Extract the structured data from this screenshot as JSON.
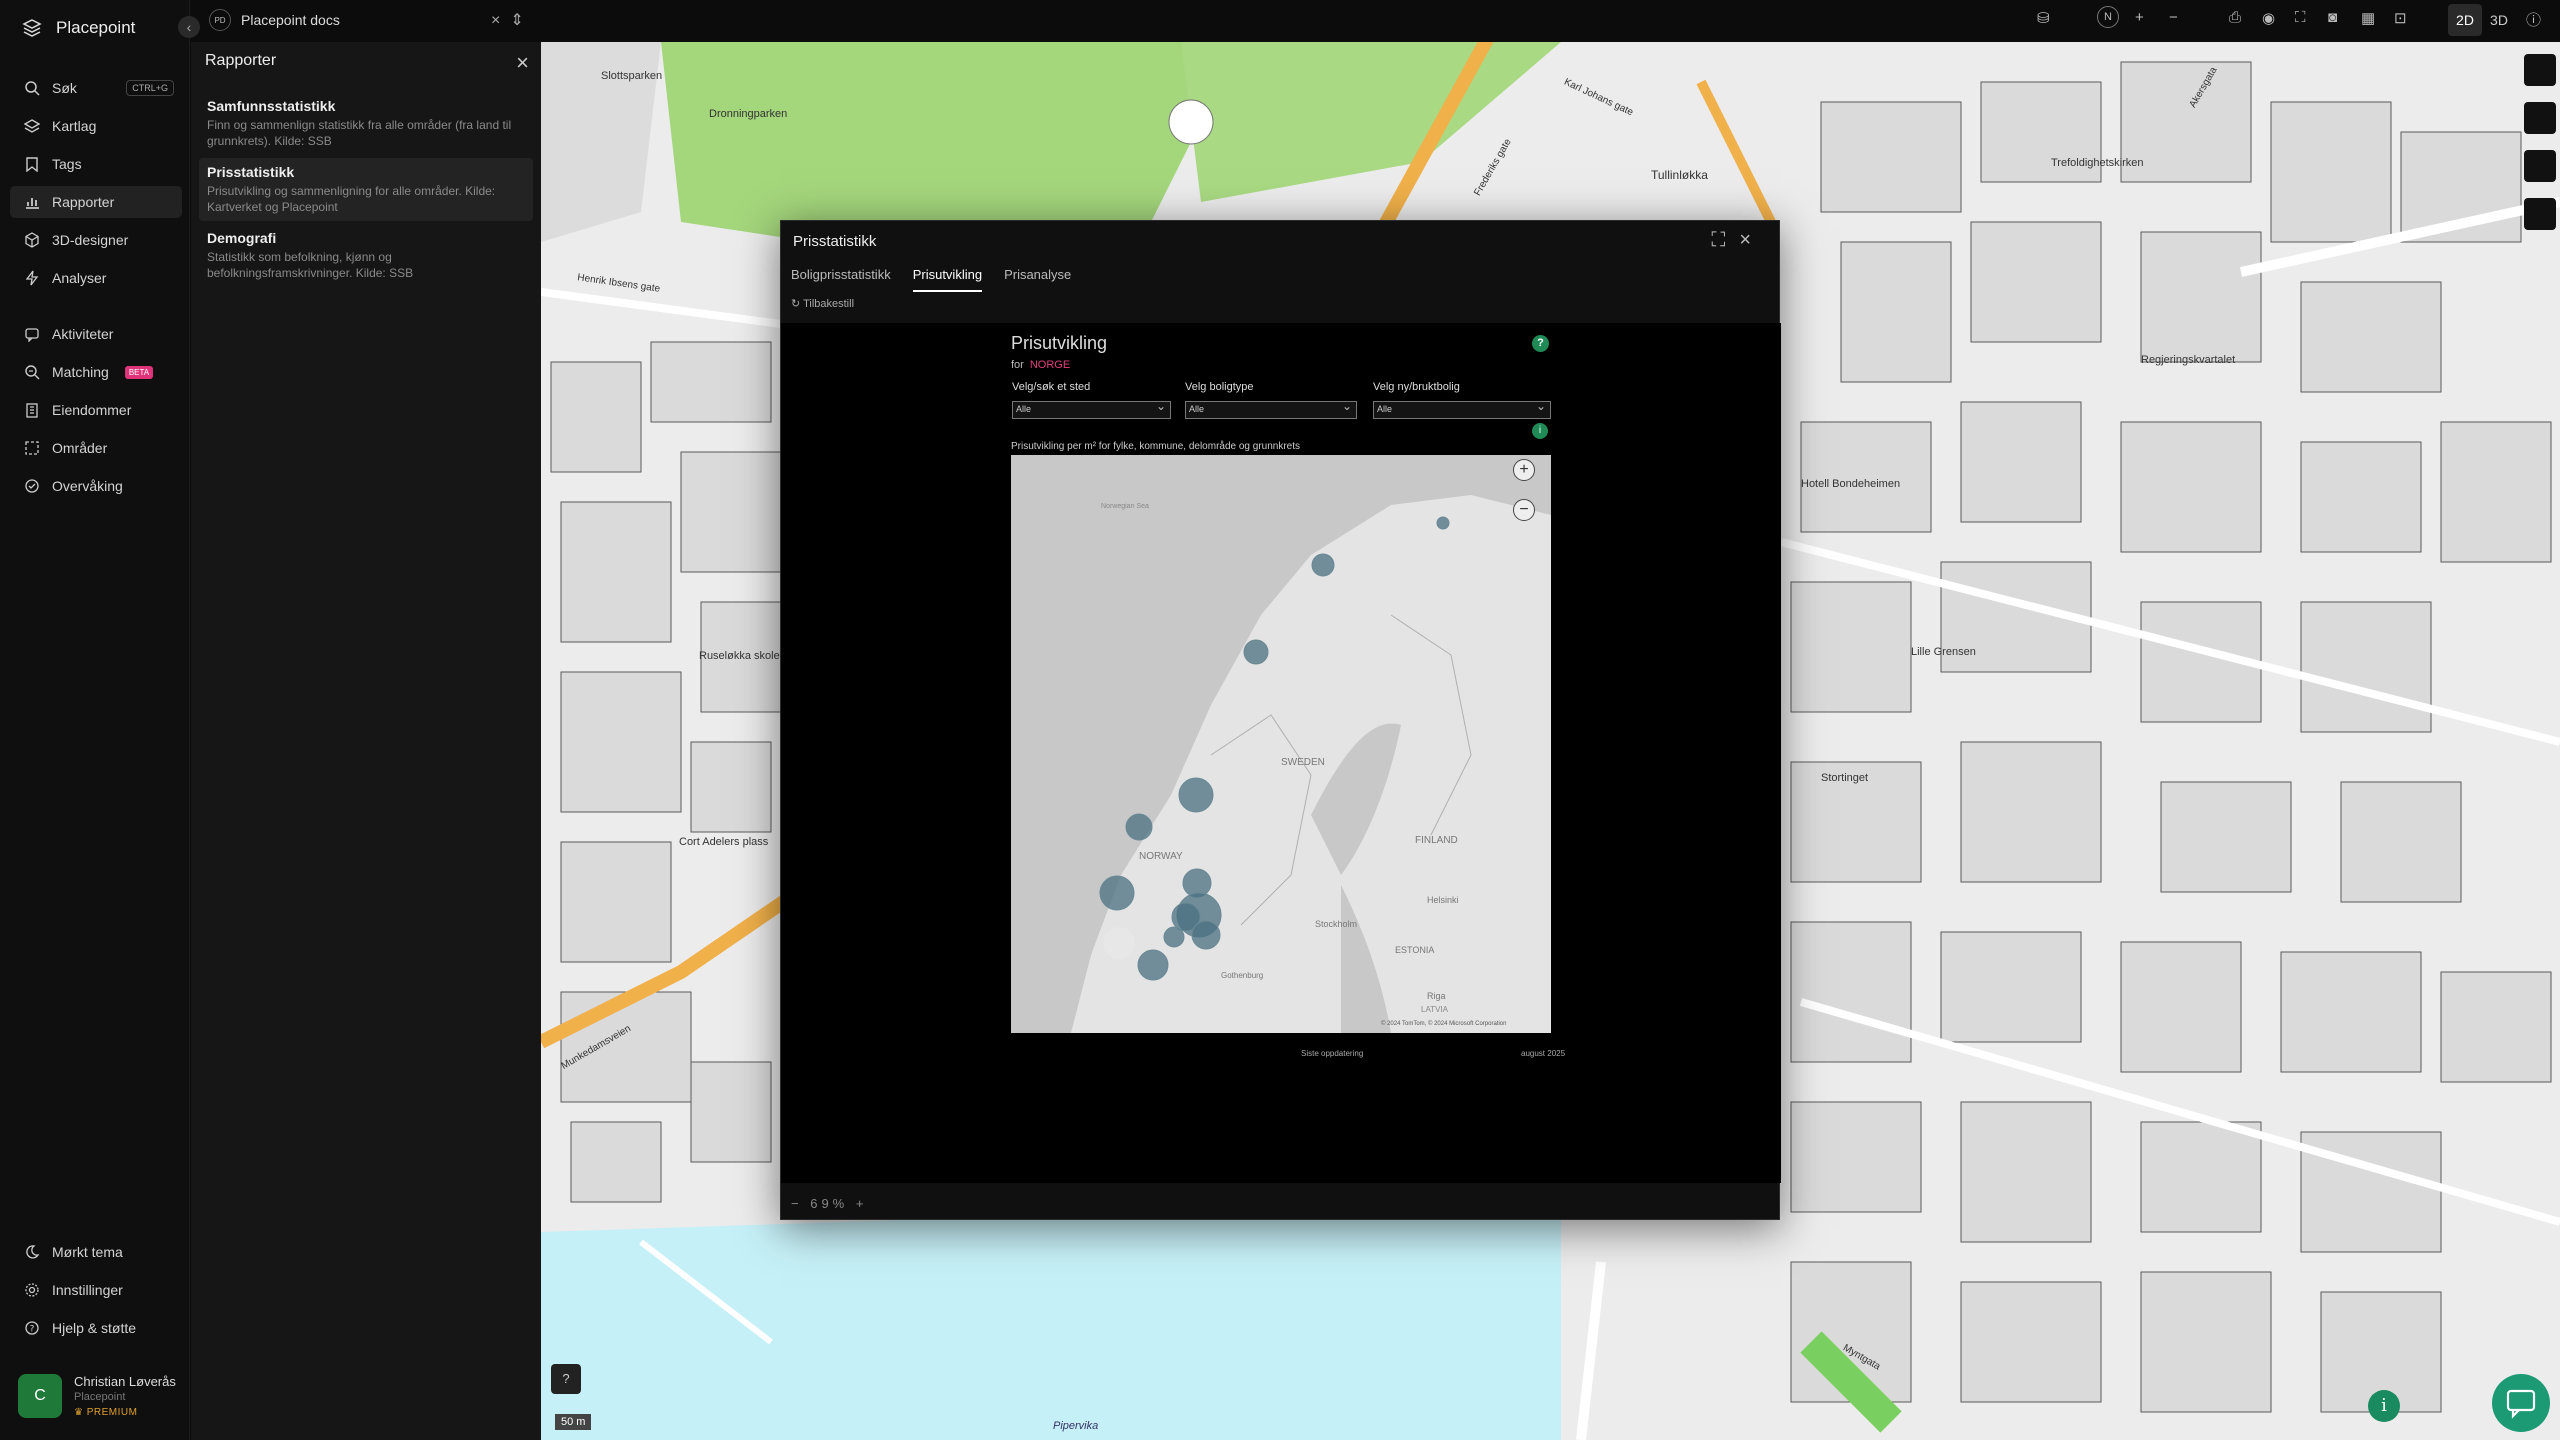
{
  "app": {
    "name": "Placepoint"
  },
  "nav": {
    "search": "Søk",
    "search_shortcut": "CTRL+G",
    "maplayers": "Kartlag",
    "tags": "Tags",
    "reports": "Rapporter",
    "designer3d": "3D-designer",
    "analyses": "Analyser",
    "activities": "Aktiviteter",
    "matching": "Matching",
    "matching_badge": "BETA",
    "properties": "Eiendommer",
    "areas": "Områder",
    "monitoring": "Overvåking",
    "dark_theme": "Mørkt tema",
    "settings": "Innstillinger",
    "help": "Hjelp & støtte"
  },
  "user": {
    "name": "Christian Løverås",
    "org": "Placepoint",
    "plan": "PREMIUM",
    "initial": "C"
  },
  "topbar": {
    "doc_badge": "PD",
    "doc_name": "Placepoint docs",
    "mode_2d": "2D",
    "mode_3d": "3D",
    "north": "N"
  },
  "panel": {
    "title": "Rapporter",
    "items": [
      {
        "title": "Samfunnsstatistikk",
        "desc": "Finn og sammenlign statistikk fra alle områder (fra land til grunnkrets). Kilde: SSB"
      },
      {
        "title": "Prisstatistikk",
        "desc": "Prisutvikling og sammenligning for alle områder. Kilde: Kartverket og Placepoint"
      },
      {
        "title": "Demografi",
        "desc": "Statistikk som befolkning, kjønn og befolkningsframskrivninger. Kilde: SSB"
      }
    ]
  },
  "modal": {
    "title": "Prisstatistikk",
    "tabs": [
      "Boligprisstatistikk",
      "Prisutvikling",
      "Prisanalyse"
    ],
    "reset": "Tilbakestill",
    "zoom": "69%"
  },
  "report": {
    "title": "Prisutvikling",
    "for_label": "for",
    "for_value": "NORGE",
    "filter1_label": "Velg/søk et sted",
    "filter1_value": "Alle",
    "filter2_label": "Velg boligtype",
    "filter2_value": "Alle",
    "filter3_label": "Velg ny/bruktbolig",
    "filter3_value": "Alle",
    "subtitle": "Prisutvikling per m² for fylke, kommune, delområde og grunnkrets",
    "map_labels": {
      "sweden": "SWEDEN",
      "norway": "NORWAY",
      "finland": "FINLAND",
      "stockholm": "Stockholm",
      "helsinki": "Helsinki",
      "estonia": "ESTONIA",
      "latvia": "LATVIA",
      "riga": "Riga",
      "gothenburg": "Gothenburg",
      "sea": "Norwegian Sea",
      "copyright": "© 2024 TomTom, © 2024 Microsoft Corporation"
    },
    "updated_label": "Siste oppdatering",
    "updated_value": "august 2025"
  },
  "map": {
    "scale": "50 m",
    "labels": {
      "slottsparken": "Slottsparken",
      "dronningparken": "Dronningparken",
      "tullinlokka": "Tullinløkka",
      "trefoldighet": "Trefoldighetskirken",
      "regjering": "Regjeringskvartalet",
      "ruselokka": "Ruseløkka skole",
      "cort": "Cort Adelers plass",
      "stortinget": "Stortinget",
      "grensen": "Lille Grensen",
      "hotel": "Hotell Bondeheimen",
      "pipervika": "Pipervika",
      "karljohan": "Karl Johans gate",
      "frederiks": "Frederiks gate",
      "henrik": "Henrik Ibsens gate",
      "munkedams": "Munkedamsveien",
      "myntgata": "Myntgata",
      "akersgata": "Akersgata"
    }
  }
}
